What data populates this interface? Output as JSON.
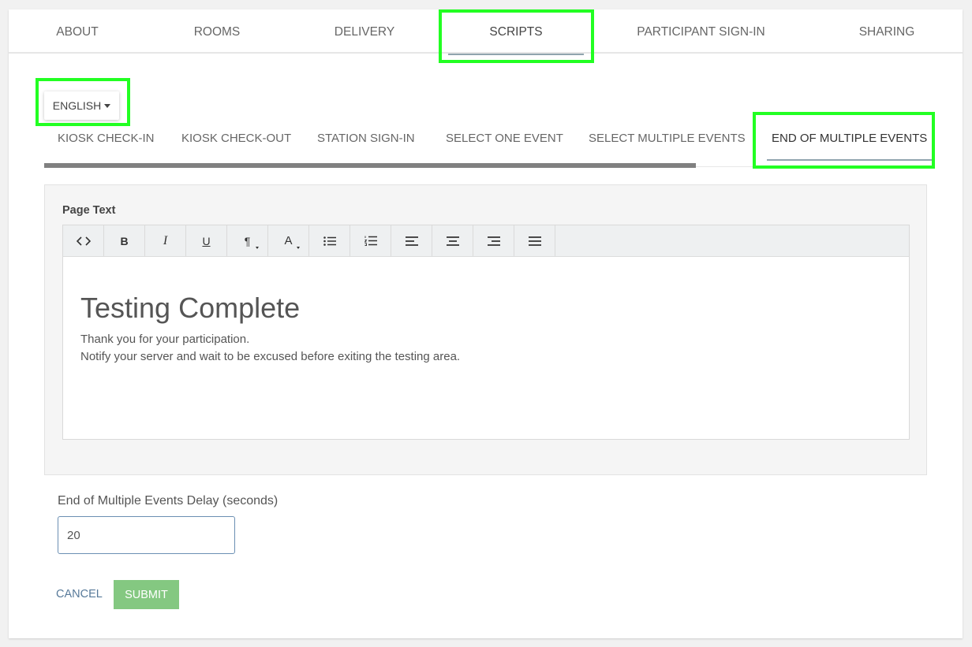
{
  "top_tabs": [
    {
      "label": "ABOUT"
    },
    {
      "label": "ROOMS"
    },
    {
      "label": "DELIVERY"
    },
    {
      "label": "SCRIPTS",
      "active": true
    },
    {
      "label": "PARTICIPANT SIGN-IN"
    },
    {
      "label": "SHARING"
    }
  ],
  "language": {
    "selected": "ENGLISH"
  },
  "sub_tabs": [
    {
      "label": "KIOSK CHECK-IN"
    },
    {
      "label": "KIOSK CHECK-OUT"
    },
    {
      "label": "STATION SIGN-IN"
    },
    {
      "label": "SELECT ONE EVENT"
    },
    {
      "label": "SELECT MULTIPLE EVENTS"
    },
    {
      "label": "END OF MULTIPLE EVENTS",
      "active": true
    }
  ],
  "editor": {
    "label": "Page Text",
    "toolbar": [
      "code-view-icon",
      "bold-icon",
      "italic-icon",
      "underline-icon",
      "paragraph-icon",
      "font-color-icon",
      "bullet-list-icon",
      "numbered-list-icon",
      "align-left-icon",
      "align-center-icon",
      "align-right-icon",
      "justify-icon"
    ],
    "toolbar_text": {
      "bold": "B",
      "italic": "I",
      "underline": "U",
      "paragraph": "¶",
      "font_color": "A"
    },
    "heading": "Testing Complete",
    "lines": [
      "Thank you for your participation.",
      "Notify your server and wait to be excused before exiting the testing area."
    ]
  },
  "delay": {
    "label": "End of Multiple Events Delay (seconds)",
    "value": "20"
  },
  "actions": {
    "cancel": "CANCEL",
    "submit": "SUBMIT"
  },
  "colors": {
    "highlight": "#22ff22",
    "submit": "#84c881",
    "tab_underline": "#90a4ae",
    "progress": "#808080"
  }
}
